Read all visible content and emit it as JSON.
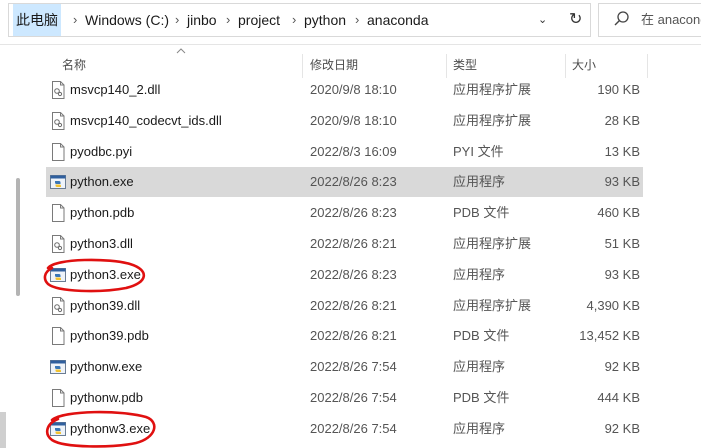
{
  "address": {
    "crumbs": [
      "此电脑",
      "Windows (C:)",
      "jinbo",
      "project",
      "python",
      "anaconda"
    ],
    "separator": "›",
    "dropdown": "⌄",
    "refresh": "↻"
  },
  "search": {
    "placeholder": "在 anaconda"
  },
  "columns": {
    "name": "名称",
    "date": "修改日期",
    "type": "类型",
    "size": "大小"
  },
  "files": [
    {
      "name": "msvcp140_2.dll",
      "date": "2020/9/8 18:10",
      "type": "应用程序扩展",
      "size": "190 KB",
      "icon": "dll-icon"
    },
    {
      "name": "msvcp140_codecvt_ids.dll",
      "date": "2020/9/8 18:10",
      "type": "应用程序扩展",
      "size": "28 KB",
      "icon": "dll-icon"
    },
    {
      "name": "pyodbc.pyi",
      "date": "2022/8/3 16:09",
      "type": "PYI 文件",
      "size": "13 KB",
      "icon": "file-icon"
    },
    {
      "name": "python.exe",
      "date": "2022/8/26 8:23",
      "type": "应用程序",
      "size": "93 KB",
      "icon": "python-exe-icon",
      "selected": true
    },
    {
      "name": "python.pdb",
      "date": "2022/8/26 8:23",
      "type": "PDB 文件",
      "size": "460 KB",
      "icon": "file-icon"
    },
    {
      "name": "python3.dll",
      "date": "2022/8/26 8:21",
      "type": "应用程序扩展",
      "size": "51 KB",
      "icon": "dll-icon"
    },
    {
      "name": "python3.exe",
      "date": "2022/8/26 8:23",
      "type": "应用程序",
      "size": "93 KB",
      "icon": "python-exe-icon",
      "circled": true
    },
    {
      "name": "python39.dll",
      "date": "2022/8/26 8:21",
      "type": "应用程序扩展",
      "size": "4,390 KB",
      "icon": "dll-icon"
    },
    {
      "name": "python39.pdb",
      "date": "2022/8/26 8:21",
      "type": "PDB 文件",
      "size": "13,452 KB",
      "icon": "file-icon"
    },
    {
      "name": "pythonw.exe",
      "date": "2022/8/26 7:54",
      "type": "应用程序",
      "size": "92 KB",
      "icon": "pythonw-exe-icon"
    },
    {
      "name": "pythonw.pdb",
      "date": "2022/8/26 7:54",
      "type": "PDB 文件",
      "size": "444 KB",
      "icon": "file-icon"
    },
    {
      "name": "pythonw3.exe",
      "date": "2022/8/26 7:54",
      "type": "应用程序",
      "size": "92 KB",
      "icon": "pythonw-exe-icon",
      "circled": true
    }
  ],
  "colors": {
    "selection": "#d9d9d9",
    "address_highlight": "#cde8ff",
    "annotation": "#e01010"
  }
}
